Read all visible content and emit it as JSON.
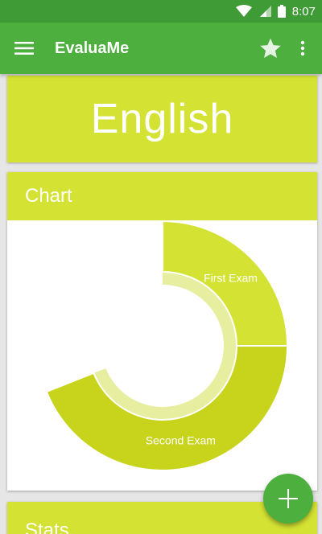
{
  "status_bar": {
    "time": "8:07"
  },
  "app_bar": {
    "title": "EvaluaMe"
  },
  "subject": {
    "title": "English"
  },
  "chart_card": {
    "header": "Chart"
  },
  "stats_card": {
    "header": "Stats"
  },
  "colors": {
    "status_bar": "#3f9b35",
    "app_bar": "#4caf3e",
    "card_accent": "#d4e233",
    "slice_1": "#d4e233",
    "slice_2": "#c8d41c",
    "inner_ring": "#e7eea0"
  },
  "icons": {
    "menu": "hamburger-menu-icon",
    "favorite": "star-icon",
    "overflow": "more-vert-icon",
    "fab": "plus-icon"
  },
  "chart_data": {
    "type": "pie",
    "categories": [
      "First Exam",
      "Second Exam"
    ],
    "values": [
      25,
      44
    ]
  }
}
